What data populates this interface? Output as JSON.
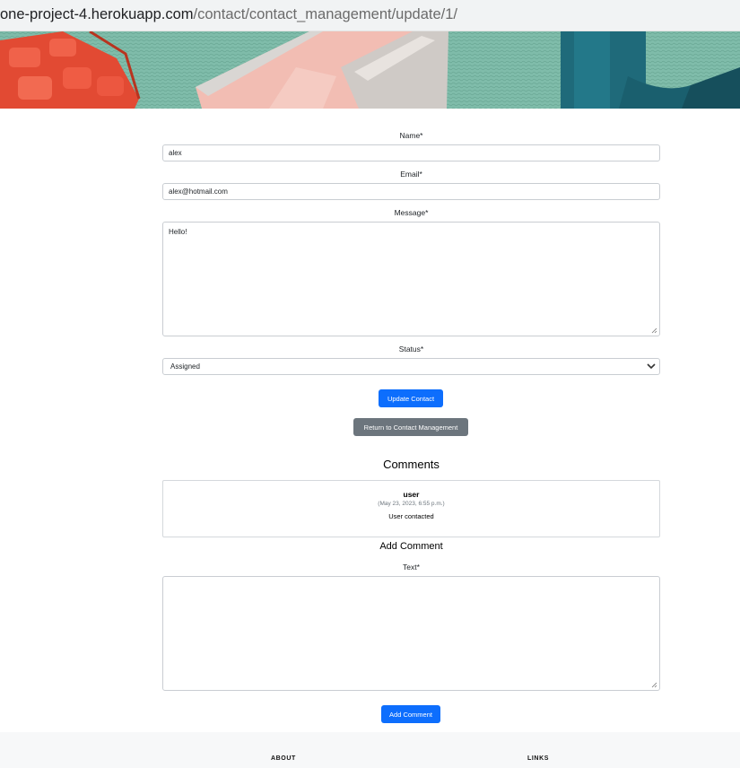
{
  "browser": {
    "url_host": "one-project-4.herokuapp.com",
    "url_path": "/contact/contact_management/update/1/"
  },
  "form": {
    "name_label": "Name*",
    "name_value": "alex",
    "email_label": "Email*",
    "email_value": "alex@hotmail.com",
    "message_label": "Message*",
    "message_value": "Hello!",
    "status_label": "Status*",
    "status_value": "Assigned",
    "update_button": "Update Contact",
    "return_button": "Return to Contact Management"
  },
  "comments": {
    "heading": "Comments",
    "items": [
      {
        "user": "user",
        "date": "(May 23, 2023, 6:55 p.m.)",
        "text": "User contacted"
      }
    ]
  },
  "add_comment": {
    "heading": "Add Comment",
    "text_label": "Text*",
    "text_value": "",
    "button": "Add Comment"
  },
  "footer": {
    "about": "ABOUT",
    "links": "LINKS"
  }
}
